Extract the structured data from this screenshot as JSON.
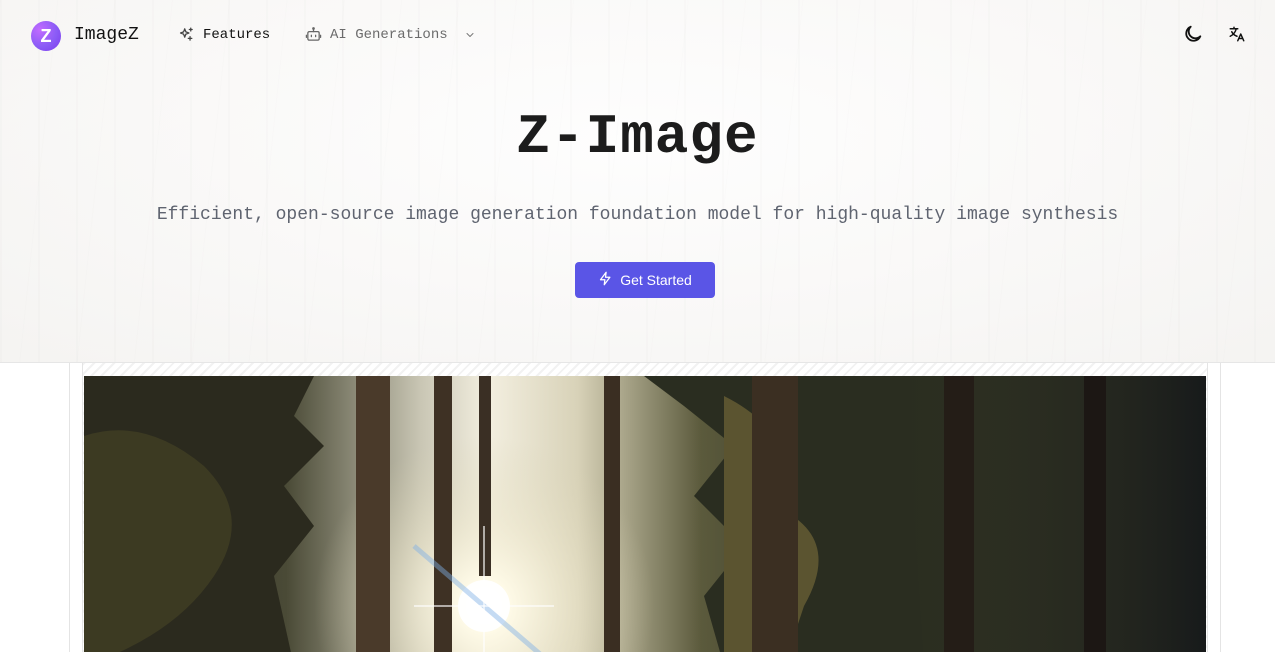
{
  "nav": {
    "brand": "ImageZ",
    "logo_letter": "Z",
    "features_label": "Features",
    "ai_generations_label": "AI Generations",
    "icons": {
      "features": "sparkles-icon",
      "ai_generations": "robot-icon",
      "dropdown": "chevron-down-icon",
      "theme": "moon-icon",
      "language": "translate-icon"
    }
  },
  "hero": {
    "title": "Z-Image",
    "subtitle": "Efficient, open-source image generation foundation model for high-quality image synthesis",
    "cta_label": "Get Started",
    "cta_icon": "lightning-icon"
  },
  "colors": {
    "accent": "#5a55e6",
    "logo_gradient_start": "#c26bff",
    "logo_gradient_end": "#7c3aed",
    "subtitle": "#5f6470"
  },
  "showcase": {
    "image_subject": "sunlit forest"
  }
}
